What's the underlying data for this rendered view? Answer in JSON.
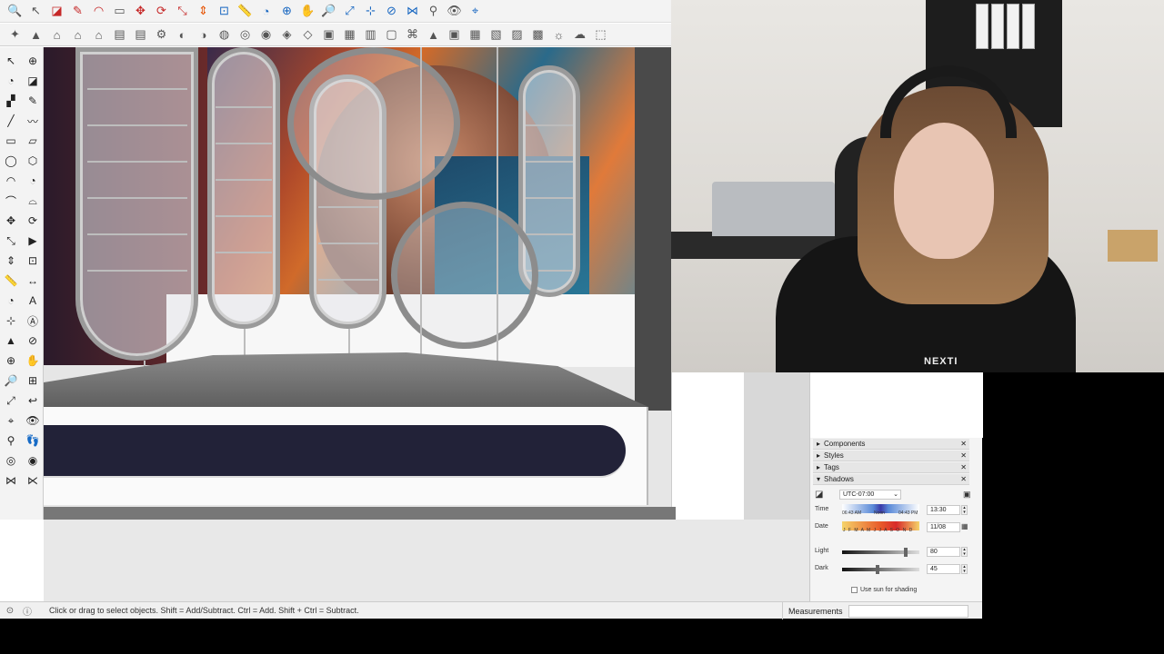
{
  "toolbar1": {
    "icons": [
      "search-icon",
      "select-arrow-icon",
      "eraser-icon",
      "pencil-icon",
      "arc-icon",
      "rectangle-icon",
      "move-icon",
      "rotate-icon",
      "scale-icon",
      "pushpull-icon",
      "offset-icon",
      "tape-icon",
      "protractor-icon",
      "orbit-icon",
      "pan-icon",
      "zoom-icon",
      "zoom-extents-icon",
      "axes-icon",
      "section-icon",
      "sandbox-icon",
      "walk-icon",
      "look-icon",
      "position-camera-icon"
    ],
    "glyphs": [
      "🔍",
      "↖",
      "◪",
      "✎",
      "◠",
      "▭",
      "✥",
      "⟳",
      "⤡",
      "⇕",
      "⊡",
      "📏",
      "◔",
      "⊕",
      "✋",
      "🔎",
      "⤢",
      "⊹",
      "⊘",
      "⋈",
      "⚲",
      "👁",
      "⌖"
    ]
  },
  "toolbar2": {
    "icons": [
      "pencil-grab-icon",
      "paint-icon",
      "home-view-icon",
      "house-icon",
      "front-view-icon",
      "folder-icon",
      "warehouse-icon",
      "extension-icon",
      "style-x-ray-icon",
      "style-back-edges-icon",
      "style-wireframe-icon",
      "style-hidden-icon",
      "style-shaded-icon",
      "style-textured-icon",
      "style-monochrome-icon",
      "components-icon",
      "tags-icon",
      "layers-icon",
      "lock-icon",
      "iso-view-icon",
      "top-view-icon",
      "front-icon",
      "right-icon",
      "back-icon",
      "left-icon",
      "camera-icon",
      "shadow-icon",
      "fog-icon",
      "solid-icon"
    ],
    "glyphs": [
      "✦",
      "▲",
      "⌂",
      "⌂",
      "⌂",
      "▤",
      "▤",
      "⚙",
      "◐",
      "◑",
      "◍",
      "◎",
      "◉",
      "◈",
      "◇",
      "▣",
      "▦",
      "▥",
      "▢",
      "⌘",
      "▲",
      "▣",
      "▦",
      "▧",
      "▨",
      "▩",
      "☼",
      "☁",
      "⬚"
    ]
  },
  "lefttools": {
    "icons": [
      "select-icon",
      "orbit-icon",
      "paint-bucket-icon",
      "eraser-icon",
      "paint-icon",
      "pencil-icon",
      "line-icon",
      "freehand-icon",
      "rectangle-icon",
      "rotated-rectangle-icon",
      "circle-icon",
      "polygon-icon",
      "arc-icon",
      "pie-icon",
      "two-point-arc-icon",
      "three-point-arc-icon",
      "move-icon",
      "rotate-icon",
      "scale-icon",
      "follow-me-icon",
      "pushpull-icon",
      "offset-icon",
      "tape-icon",
      "dimension-icon",
      "protractor-icon",
      "text-icon",
      "axes-icon",
      "3d-text-icon",
      "paint-bucket-icon-2",
      "section-plane-icon",
      "orbit-icon-2",
      "pan-icon",
      "zoom-icon",
      "zoom-window-icon",
      "zoom-extents-icon",
      "previous-view-icon",
      "position-camera-icon",
      "look-around-icon",
      "walk-icon",
      "footprint-icon",
      "section-icon",
      "section-display-icon",
      "sandbox-icon",
      "sandbox-2-icon"
    ],
    "glyphs": [
      "↖",
      "⊕",
      "◔",
      "◪",
      "▞",
      "✎",
      "╱",
      "〰",
      "▭",
      "▱",
      "◯",
      "⬡",
      "◠",
      "◔",
      "⌒",
      "⌓",
      "✥",
      "⟳",
      "⤡",
      "▶",
      "⇕",
      "⊡",
      "📏",
      "↔",
      "◔",
      "A",
      "⊹",
      "Ⓐ",
      "▲",
      "⊘",
      "⊕",
      "✋",
      "🔎",
      "⊞",
      "⤢",
      "↩",
      "⌖",
      "👁",
      "⚲",
      "👣",
      "◎",
      "◉",
      "⋈",
      "⋉"
    ]
  },
  "tray": {
    "sections": [
      {
        "label": "Components",
        "expanded": false
      },
      {
        "label": "Styles",
        "expanded": false
      },
      {
        "label": "Tags",
        "expanded": false
      },
      {
        "label": "Shadows",
        "expanded": true
      }
    ],
    "shadows": {
      "timezone": "UTC-07:00",
      "time_label": "Time",
      "time_start": "06:43 AM",
      "time_mid": "Noon",
      "time_end": "04:43 PM",
      "time_value": "13:30",
      "date_label": "Date",
      "months": "J F M A M J J A S O N D",
      "date_value": "11/08",
      "light_label": "Light",
      "light_value": "80",
      "dark_label": "Dark",
      "dark_value": "45",
      "use_sun_label": "Use sun for shading"
    }
  },
  "status": {
    "hint": "Click or drag to select objects. Shift = Add/Subtract. Ctrl = Add. Shift + Ctrl = Subtract.",
    "measurements_label": "Measurements"
  },
  "webcam": {
    "hoodie_text": "NEXTI"
  }
}
